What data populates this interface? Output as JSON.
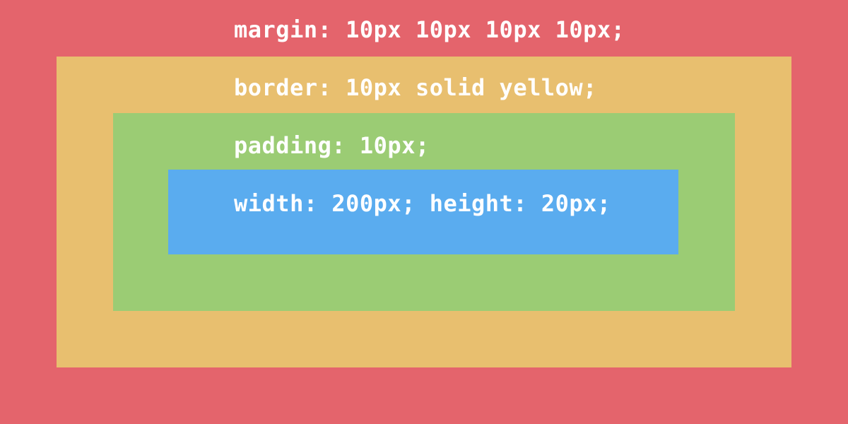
{
  "layers": {
    "margin": {
      "label": "margin: 10px 10px 10px 10px;",
      "color": "#e4646c"
    },
    "border": {
      "label": "border: 10px solid yellow;",
      "color": "#e8bf6f"
    },
    "padding": {
      "label": "padding: 10px;",
      "color": "#9bcc74"
    },
    "content": {
      "label": "width: 200px; height: 20px;",
      "color": "#5aacef"
    }
  }
}
